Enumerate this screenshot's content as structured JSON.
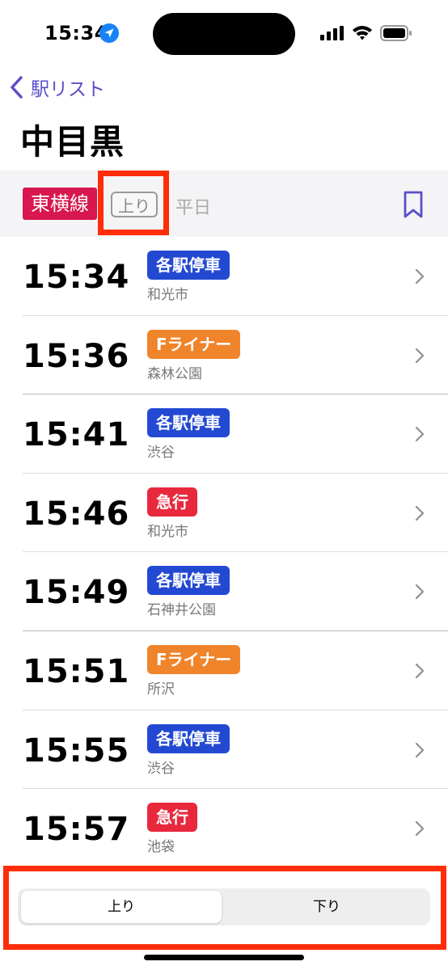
{
  "status_bar": {
    "time": "15:34"
  },
  "nav": {
    "back_label": "駅リスト"
  },
  "page": {
    "title": "中目黒"
  },
  "filter": {
    "line_name": "東横線",
    "line_color": "#d8174e",
    "direction": "上り",
    "day_type": "平日"
  },
  "train_types": {
    "local": {
      "label": "各駅停車",
      "color": "#2349d3"
    },
    "f_liner": {
      "label": "Fライナー",
      "color": "#f0842a"
    },
    "express": {
      "label": "急行",
      "color": "#e8293d"
    }
  },
  "trains": [
    {
      "time": "15:34",
      "type": "各駅停車",
      "type_color": "#2349d3",
      "destination": "和光市"
    },
    {
      "time": "15:36",
      "type": "Fライナー",
      "type_color": "#f0842a",
      "destination": "森林公園"
    },
    {
      "time": "15:41",
      "type": "各駅停車",
      "type_color": "#2349d3",
      "destination": "渋谷"
    },
    {
      "time": "15:46",
      "type": "急行",
      "type_color": "#e8293d",
      "destination": "和光市"
    },
    {
      "time": "15:49",
      "type": "各駅停車",
      "type_color": "#2349d3",
      "destination": "石神井公園"
    },
    {
      "time": "15:51",
      "type": "Fライナー",
      "type_color": "#f0842a",
      "destination": "所沢"
    },
    {
      "time": "15:55",
      "type": "各駅停車",
      "type_color": "#2349d3",
      "destination": "渋谷"
    },
    {
      "time": "15:57",
      "type": "急行",
      "type_color": "#e8293d",
      "destination": "池袋"
    }
  ],
  "segmented_control": {
    "up_label": "上り",
    "down_label": "下り",
    "selected": "上り"
  },
  "icons": [
    "location-arrow-icon",
    "cellular-signal-icon",
    "wifi-icon",
    "battery-icon",
    "back-chevron-icon",
    "bookmark-icon",
    "chevron-right-icon"
  ],
  "accent_color": "#5a4fc8",
  "highlight_color": "#ff2d0a"
}
